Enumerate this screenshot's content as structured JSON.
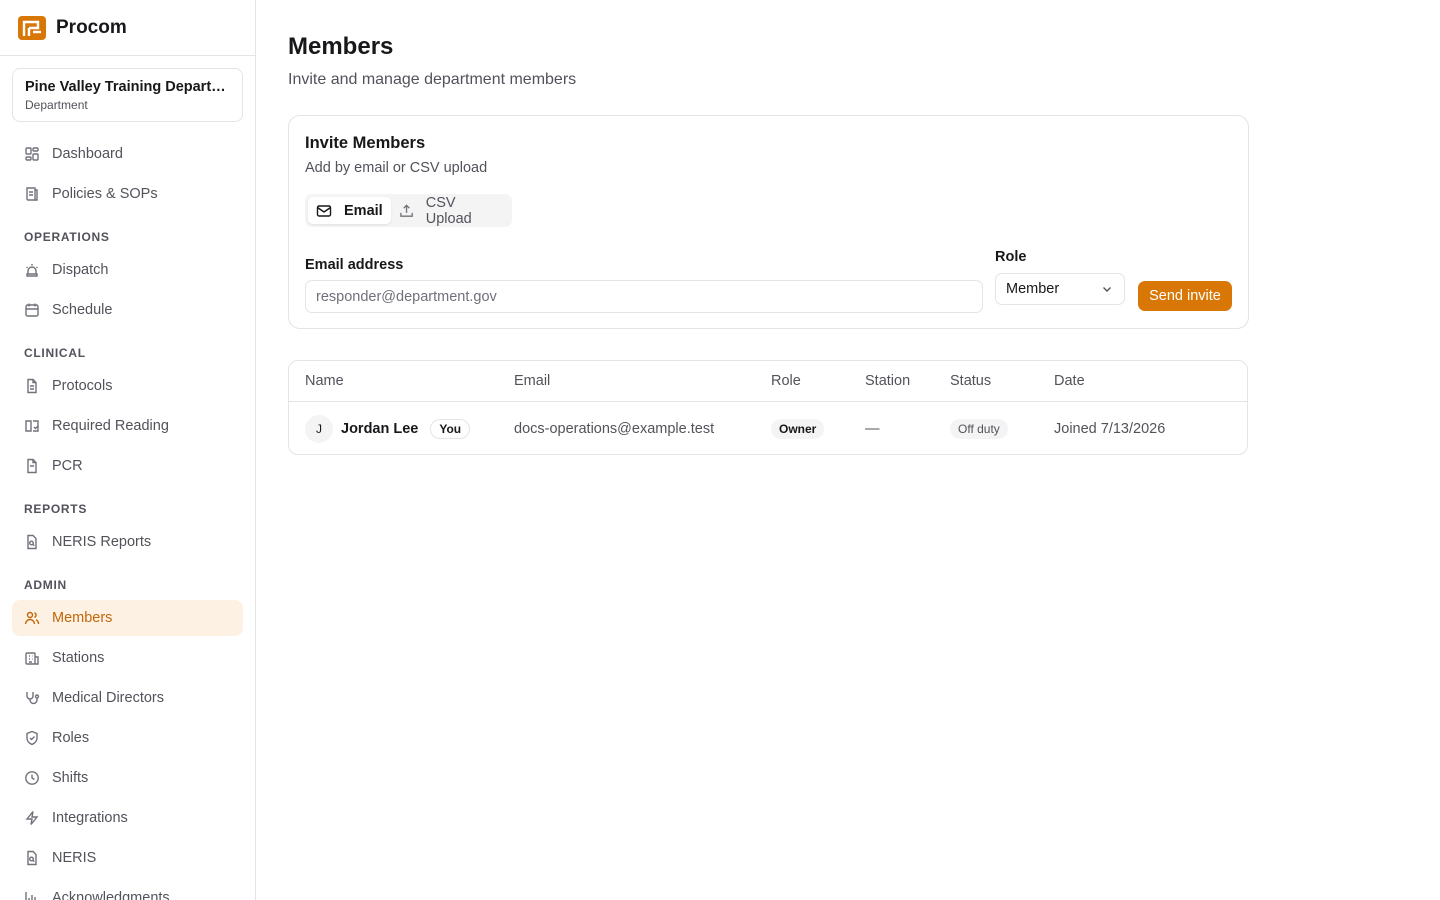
{
  "app": {
    "name": "Procom",
    "accent": "#d97706"
  },
  "department": {
    "name": "Pine Valley Training Department",
    "type": "Department"
  },
  "sidebar": {
    "top_items": [
      {
        "label": "Dashboard",
        "icon": "dashboard-icon"
      },
      {
        "label": "Policies & SOPs",
        "icon": "book-icon"
      }
    ],
    "sections": [
      {
        "label": "OPERATIONS",
        "items": [
          {
            "label": "Dispatch",
            "icon": "siren-icon"
          },
          {
            "label": "Schedule",
            "icon": "calendar-icon"
          }
        ]
      },
      {
        "label": "CLINICAL",
        "items": [
          {
            "label": "Protocols",
            "icon": "file-text-icon"
          },
          {
            "label": "Required Reading",
            "icon": "book-open-check-icon"
          },
          {
            "label": "PCR",
            "icon": "file-icon"
          }
        ]
      },
      {
        "label": "REPORTS",
        "items": [
          {
            "label": "NERIS Reports",
            "icon": "file-search-icon"
          }
        ]
      },
      {
        "label": "ADMIN",
        "items": [
          {
            "label": "Members",
            "icon": "users-icon",
            "active": true
          },
          {
            "label": "Stations",
            "icon": "building-icon"
          },
          {
            "label": "Medical Directors",
            "icon": "stethoscope-icon"
          },
          {
            "label": "Roles",
            "icon": "shield-icon"
          },
          {
            "label": "Shifts",
            "icon": "clock-icon"
          },
          {
            "label": "Integrations",
            "icon": "zap-icon"
          },
          {
            "label": "NERIS",
            "icon": "file-search-icon"
          },
          {
            "label": "Acknowledgments",
            "icon": "chart-icon"
          }
        ]
      }
    ]
  },
  "page": {
    "title": "Members",
    "subtitle": "Invite and manage department members"
  },
  "invite": {
    "title": "Invite Members",
    "subtitle": "Add by email or CSV upload",
    "tabs": [
      {
        "label": "Email",
        "icon": "mail-icon",
        "active": true
      },
      {
        "label": "CSV Upload",
        "icon": "upload-icon",
        "active": false
      }
    ],
    "email_label": "Email address",
    "email_placeholder": "responder@department.gov",
    "email_value": "",
    "role_label": "Role",
    "role_value": "Member",
    "send_label": "Send invite"
  },
  "members_table": {
    "columns": [
      "Name",
      "Email",
      "Role",
      "Station",
      "Status",
      "Date"
    ],
    "rows": [
      {
        "initial": "J",
        "name": "Jordan Lee",
        "badge": "You",
        "email": "docs-operations@example.test",
        "role": "Owner",
        "station": "—",
        "status": "Off duty",
        "date": "Joined 7/13/2026"
      }
    ]
  }
}
